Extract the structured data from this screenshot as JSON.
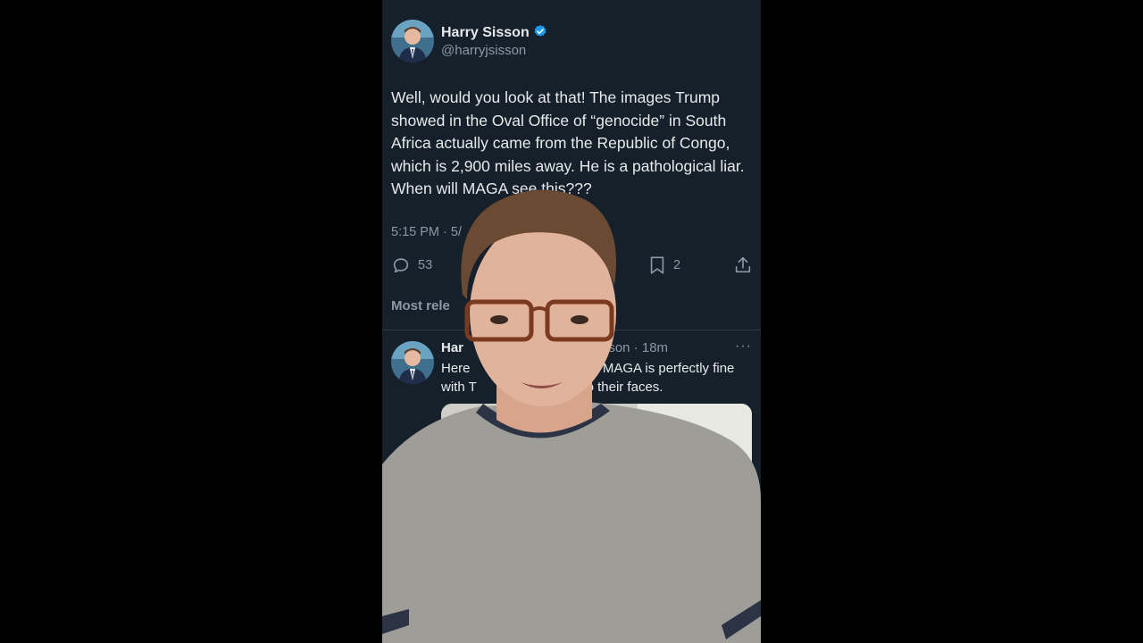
{
  "tweet": {
    "author_name": "Harry Sisson",
    "author_handle": "@harryjsisson",
    "text": "Well, would you look at that! The images Trump showed in the Oval Office of “genocide” in South Africa actually came from the Republic of Congo, which is 2,900 miles away. He is a pathological liar. When will MAGA see this???",
    "time_visible": "5:15 PM · 5/",
    "replies": "53",
    "bookmarks": "2"
  },
  "replies_sort_label": "Most rele",
  "reply": {
    "author_name_visible": "Har",
    "handle_visible": "sisson · 18m",
    "more": "···",
    "text_line1_a": "Here",
    "text_line1_b": ". MAGA is perfectly fine",
    "text_line2_a": "with T",
    "text_line2_b": "ht to their faces."
  },
  "colors": {
    "background": "#15202b",
    "text": "#e7e9ea",
    "muted": "#8b98a5",
    "verified": "#1d9bf0",
    "letterbox": "#000000"
  },
  "icons": [
    "verified-badge-icon",
    "reply-icon",
    "bookmark-icon",
    "share-icon",
    "more-icon"
  ]
}
